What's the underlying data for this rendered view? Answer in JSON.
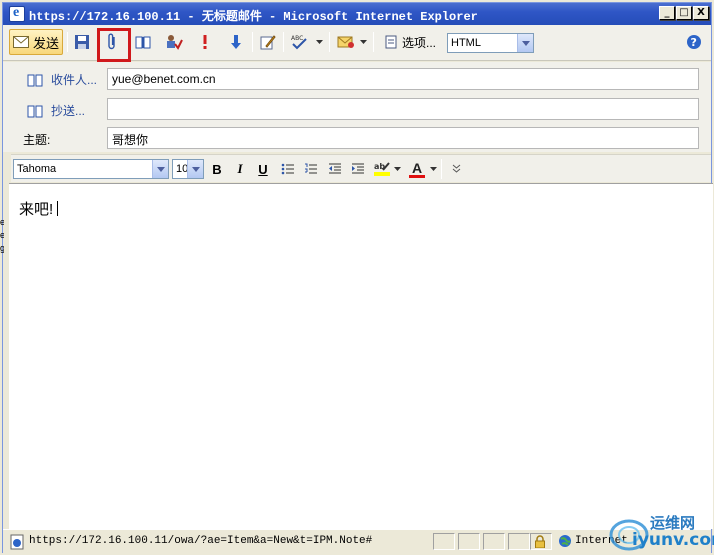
{
  "window": {
    "title": "https://172.16.100.11 - 无标题邮件 - Microsoft Internet Explorer",
    "controls": {
      "minimize": "_",
      "maximize": "□",
      "close": "X"
    }
  },
  "toolbar": {
    "send_label": "发送",
    "options_label": "选项...",
    "format_value": "HTML",
    "highlighted_button": "attach-file-button"
  },
  "headers": {
    "to_label": "收件人...",
    "to_value": "yue@benet.com.cn",
    "cc_label": "抄送...",
    "cc_value": "",
    "subject_label": "主题:",
    "subject_value": "哥想你"
  },
  "format_bar": {
    "font": "Tahoma",
    "size": "10",
    "bold": "B",
    "italic": "I",
    "underline": "U",
    "font_color_glyph": "A"
  },
  "body": {
    "text": "来吧!"
  },
  "statusbar": {
    "url": "https://172.16.100.11/owa/?ae=Item&a=New&t=IPM.Note#",
    "zone": "Internet"
  },
  "watermark": {
    "cn": "运维网",
    "en": "iyunv.com"
  },
  "colors": {
    "titlebar": "#2f56c6",
    "highlight_box": "#d0191c",
    "send_button": "#f8d77a",
    "label_blue": "#294b9c"
  }
}
